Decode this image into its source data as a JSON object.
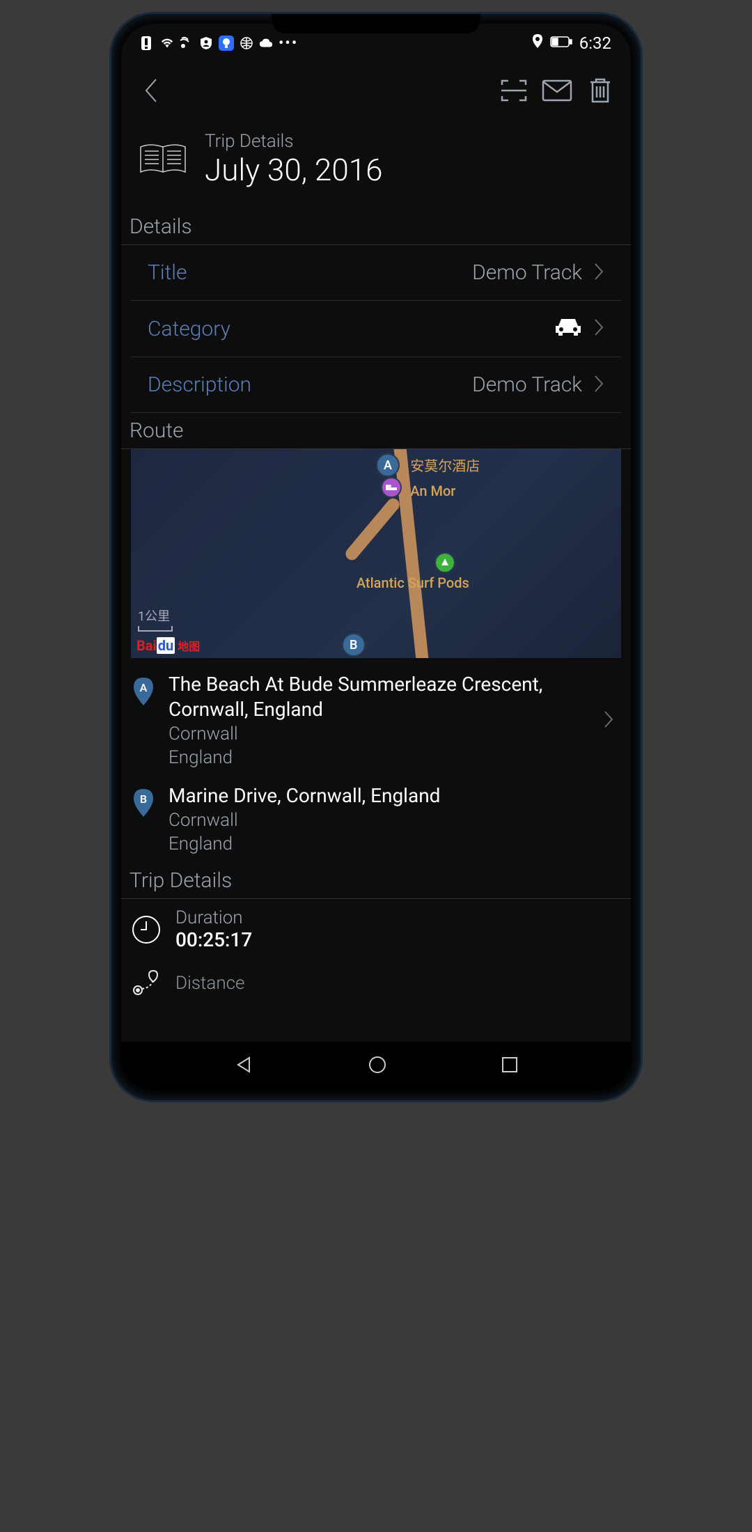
{
  "status": {
    "time": "6:32"
  },
  "header": {
    "label": "Trip Details",
    "date": "July 30, 2016"
  },
  "sections": {
    "details_label": "Details",
    "route_label": "Route",
    "trip_details_label": "Trip Details"
  },
  "details": {
    "title_label": "Title",
    "title_value": "Demo Track",
    "category_label": "Category",
    "description_label": "Description",
    "description_value": "Demo Track"
  },
  "map": {
    "poi1_cn": "安莫尔酒店",
    "poi1_en": "An Mor",
    "poi2": "Atlantic Surf Pods",
    "scale": "1公里",
    "attr_bai": "Bai",
    "attr_du": "du",
    "attr_ditu": "地图"
  },
  "route": {
    "a": {
      "letter": "A",
      "title": "The Beach At Bude Summerleaze Crescent, Cornwall, England",
      "sub1": "Cornwall",
      "sub2": "England"
    },
    "b": {
      "letter": "B",
      "title": "Marine Drive, Cornwall, England",
      "sub1": "Cornwall",
      "sub2": "England"
    }
  },
  "metrics": {
    "duration_label": "Duration",
    "duration_value": "00:25:17",
    "distance_label": "Distance"
  }
}
